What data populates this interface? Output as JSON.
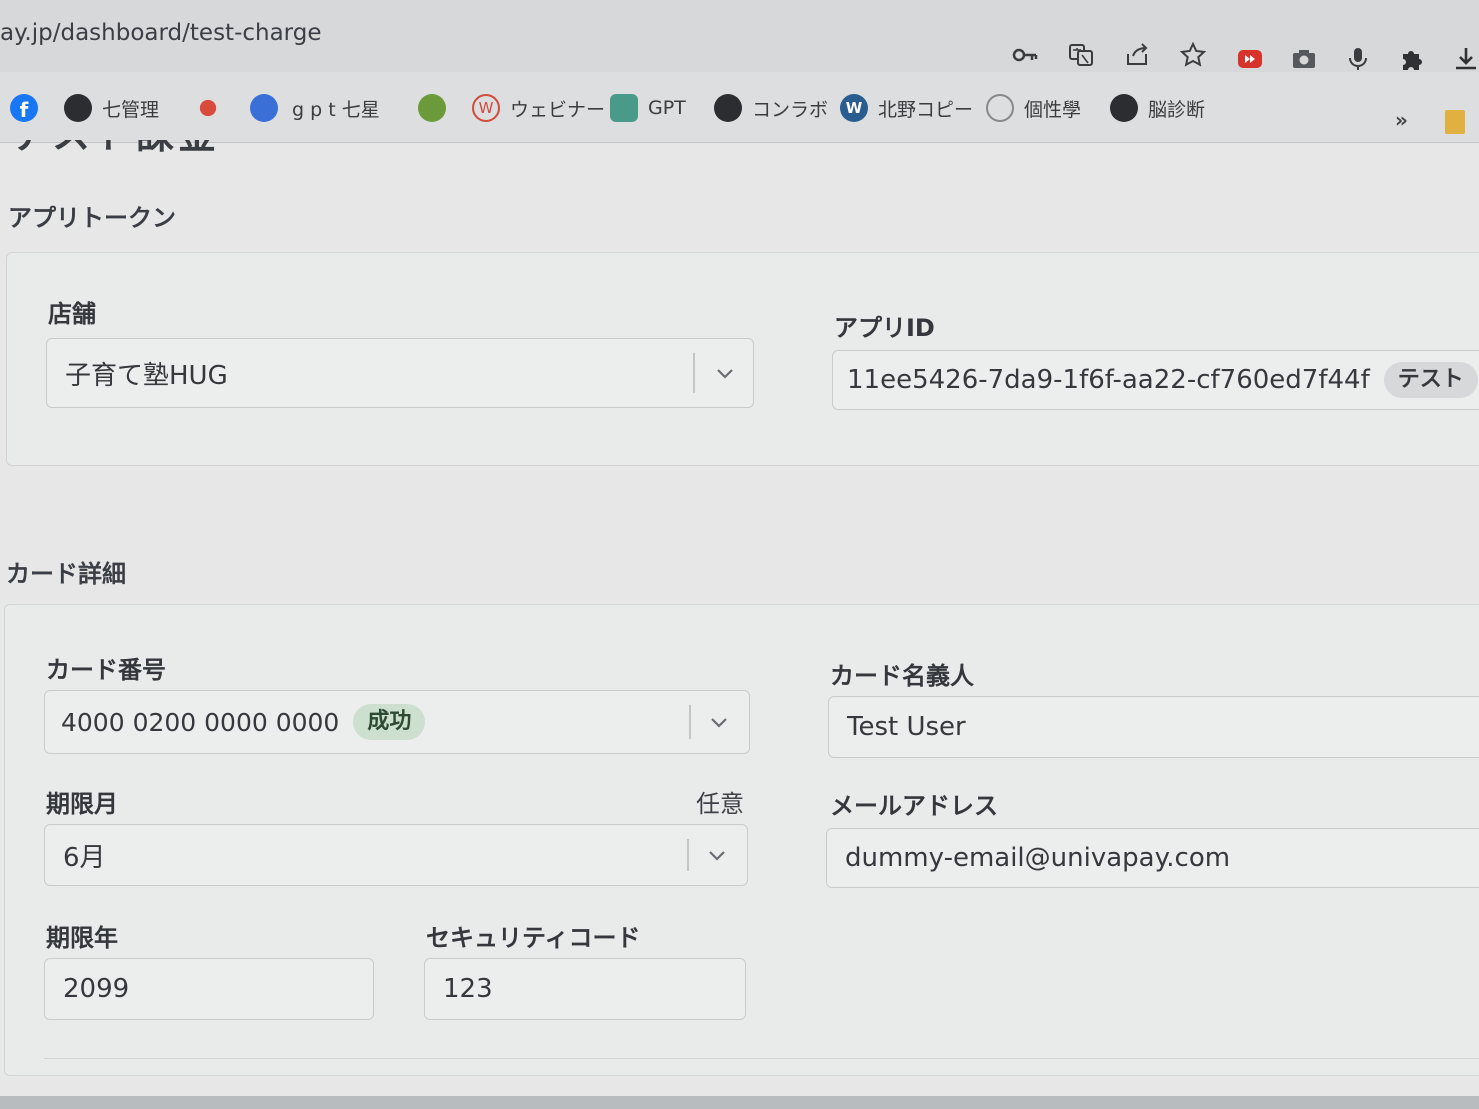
{
  "browser": {
    "url": "ay.jp/dashboard/test-charge",
    "omnibox_icons": [
      "key-icon",
      "translate-icon",
      "share-icon",
      "star-icon"
    ],
    "extension_icons": [
      "youtube-icon",
      "camera-icon",
      "microphone-icon",
      "puzzle-icon",
      "download-icon"
    ]
  },
  "bookmarks": [
    {
      "label": "",
      "icon": "facebook-icon",
      "color": "#1877f2"
    },
    {
      "label": "七管理",
      "icon": "globe-icon",
      "color": "#2b2d31"
    },
    {
      "label": "",
      "icon": "flower-icon",
      "color": "#d94a3d"
    },
    {
      "label": "g p t 七星",
      "icon": "app-icon",
      "color": "#3a6fd8"
    },
    {
      "label": "",
      "icon": "badge-icon",
      "color": "#6a9a3a"
    },
    {
      "label": "ウェビナー",
      "icon": "w-icon",
      "color": "#d24b3c"
    },
    {
      "label": "GPT",
      "icon": "openai-icon",
      "color": "#4a9a8a"
    },
    {
      "label": "コンラボ",
      "icon": "globe-icon",
      "color": "#2b2d31"
    },
    {
      "label": "北野コピー",
      "icon": "wordpress-icon",
      "color": "#2a5d8f"
    },
    {
      "label": "個性學",
      "icon": "circle-icon",
      "color": "#888888"
    },
    {
      "label": "脳診断",
      "icon": "globe-icon",
      "color": "#2b2d31"
    }
  ],
  "bookmarks_more": "»",
  "page": {
    "heading": "テスト課金"
  },
  "app_token": {
    "section_title": "アプリトークン",
    "store_label": "店舗",
    "store_value": "子育て塾HUG",
    "app_id_label": "アプリID",
    "app_id_value": "11ee5426-7da9-1f6f-aa22-cf760ed7f44f",
    "app_id_badge": "テスト"
  },
  "card": {
    "section_title": "カード詳細",
    "number_label": "カード番号",
    "number_value": "4000 0200 0000 0000",
    "number_badge": "成功",
    "holder_label": "カード名義人",
    "holder_value": "Test User",
    "exp_month_label": "期限月",
    "exp_month_optional": "任意",
    "exp_month_value": "6月",
    "email_label": "メールアドレス",
    "email_value": "dummy-email@univapay.com",
    "exp_year_label": "期限年",
    "exp_year_value": "2099",
    "cvv_label": "セキュリティコード",
    "cvv_value": "123"
  }
}
